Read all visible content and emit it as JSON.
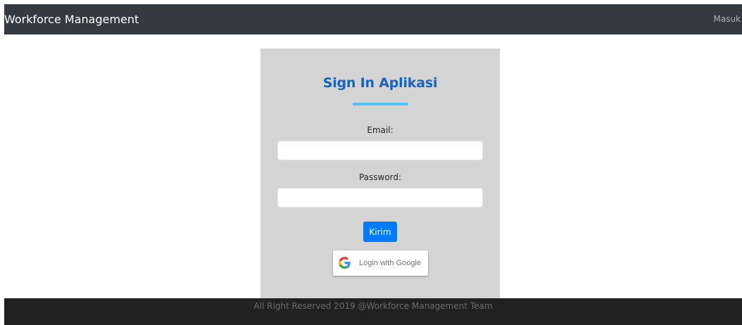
{
  "navbar": {
    "brand": "Workforce Management",
    "link": "Masuk",
    "background": "#343a40"
  },
  "login": {
    "title": "Sign In Aplikasi",
    "title_color": "#1565c0",
    "underline_color": "#4fc3f7",
    "email_label": "Email:",
    "email_value": "",
    "password_label": "Password:",
    "password_value": "",
    "submit_label": "Kirim",
    "submit_color": "#007bff",
    "google_label": "Login with Google",
    "google_icon": "google-g-icon"
  },
  "footer": {
    "text": "All Right Reserved 2019 @Workforce Management Team"
  }
}
